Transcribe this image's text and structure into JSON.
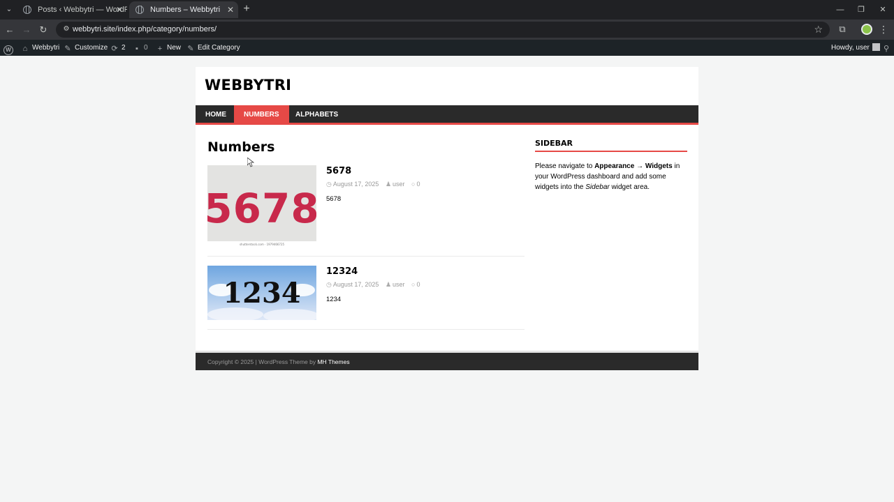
{
  "browser": {
    "tabs": [
      {
        "title": "Posts ‹ Webbytri — WordPress",
        "active": false
      },
      {
        "title": "Numbers – Webbytri",
        "active": true
      }
    ],
    "url": "webbytri.site/index.php/category/numbers/"
  },
  "adminbar": {
    "site_name": "Webbytri",
    "customize": "Customize",
    "updates_count": "2",
    "comments_count": "0",
    "new_label": "New",
    "edit_label": "Edit Category",
    "howdy": "Howdy, user"
  },
  "site": {
    "title": "WEBBYTRI",
    "nav": [
      {
        "label": "HOME",
        "current": false
      },
      {
        "label": "NUMBERS",
        "current": true
      },
      {
        "label": "ALPHABETS",
        "current": false
      }
    ],
    "archive_title": "Numbers",
    "posts": [
      {
        "title": "5678",
        "date": "August 17, 2025",
        "author": "user",
        "comments": "0",
        "excerpt": "5678",
        "thumb_text": "5678",
        "thumb_caption": "shutterstock.com · 1979466725"
      },
      {
        "title": "12324",
        "date": "August 17, 2025",
        "author": "user",
        "comments": "0",
        "excerpt": "1234",
        "thumb_text": "1234"
      }
    ],
    "sidebar": {
      "title": "SIDEBAR",
      "text_before": "Please navigate to ",
      "strong1": "Appearance",
      "arrow": " → ",
      "strong2": "Widgets",
      "text_mid": " in your WordPress dashboard and add some widgets into the ",
      "em": "Sidebar",
      "text_after": " widget area."
    },
    "footer": {
      "copyright": "Copyright © 2025 | WordPress Theme by ",
      "link": "MH Themes"
    }
  },
  "colors": {
    "accent": "#e64946",
    "nav_bg": "#2a2a2a",
    "admin_bar": "#1d2327"
  }
}
